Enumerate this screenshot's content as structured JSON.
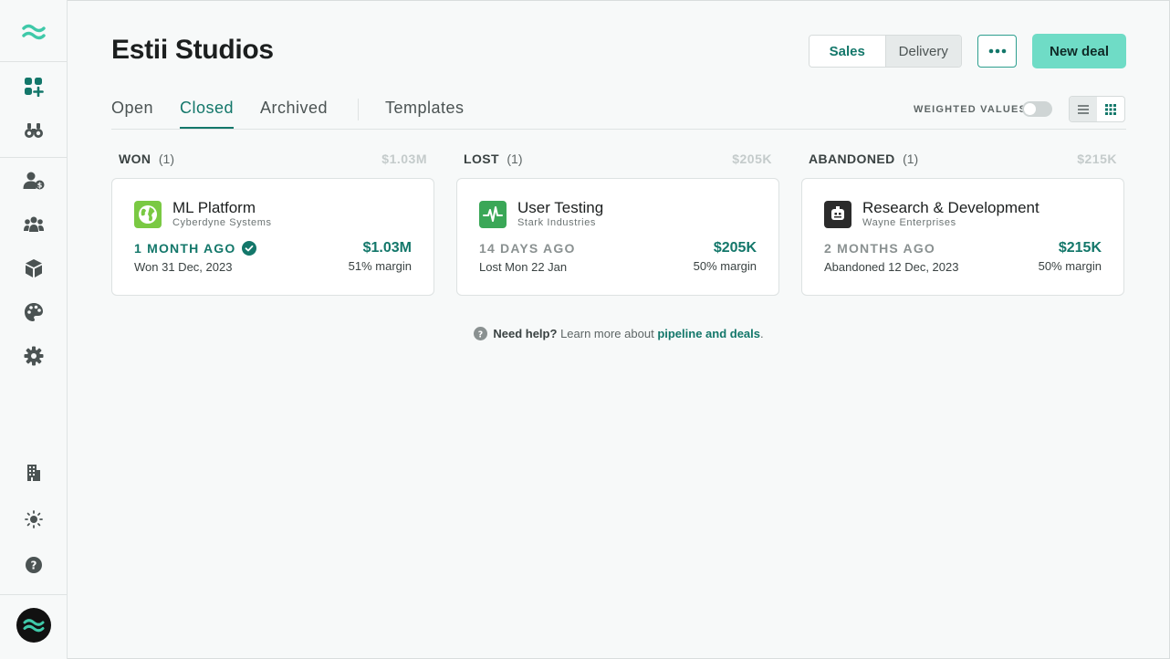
{
  "page": {
    "title": "Estii Studios"
  },
  "header": {
    "segments": [
      {
        "label": "Sales",
        "active": true
      },
      {
        "label": "Delivery",
        "active": false
      }
    ],
    "new_deal_label": "New deal"
  },
  "tabs": [
    {
      "label": "Open",
      "active": false
    },
    {
      "label": "Closed",
      "active": true
    },
    {
      "label": "Archived",
      "active": false
    },
    {
      "label": "Templates",
      "active": false
    }
  ],
  "controls": {
    "weighted_values_label": "WEIGHTED VALUES",
    "weighted_values_on": false,
    "view_mode": "grid"
  },
  "columns": [
    {
      "name": "WON",
      "count": "(1)",
      "total": "$1.03M",
      "card": {
        "title": "ML Platform",
        "company": "Cyberdyne Systems",
        "ago": "1 MONTH AGO",
        "date": "Won 31 Dec, 2023",
        "amount": "$1.03M",
        "margin": "51% margin",
        "logo_color": "#7ac943",
        "logo_icon": "globe-icon"
      }
    },
    {
      "name": "LOST",
      "count": "(1)",
      "total": "$205K",
      "card": {
        "title": "User Testing",
        "company": "Stark Industries",
        "ago": "14 DAYS AGO",
        "date": "Lost Mon 22 Jan",
        "amount": "$205K",
        "margin": "50% margin",
        "logo_color": "#3aa757",
        "logo_icon": "pulse-icon"
      }
    },
    {
      "name": "ABANDONED",
      "count": "(1)",
      "total": "$215K",
      "card": {
        "title": "Research & Development",
        "company": "Wayne Enterprises",
        "ago": "2 MONTHS AGO",
        "date": "Abandoned 12 Dec, 2023",
        "amount": "$215K",
        "margin": "50% margin",
        "logo_color": "#2b2b2b",
        "logo_icon": "robot-icon"
      }
    }
  ],
  "help": {
    "strong": "Need help?",
    "text": "Learn more about",
    "link": "pipeline and deals",
    "trailing": "."
  },
  "colors": {
    "accent": "#13776a",
    "button": "#6fdcc6"
  }
}
